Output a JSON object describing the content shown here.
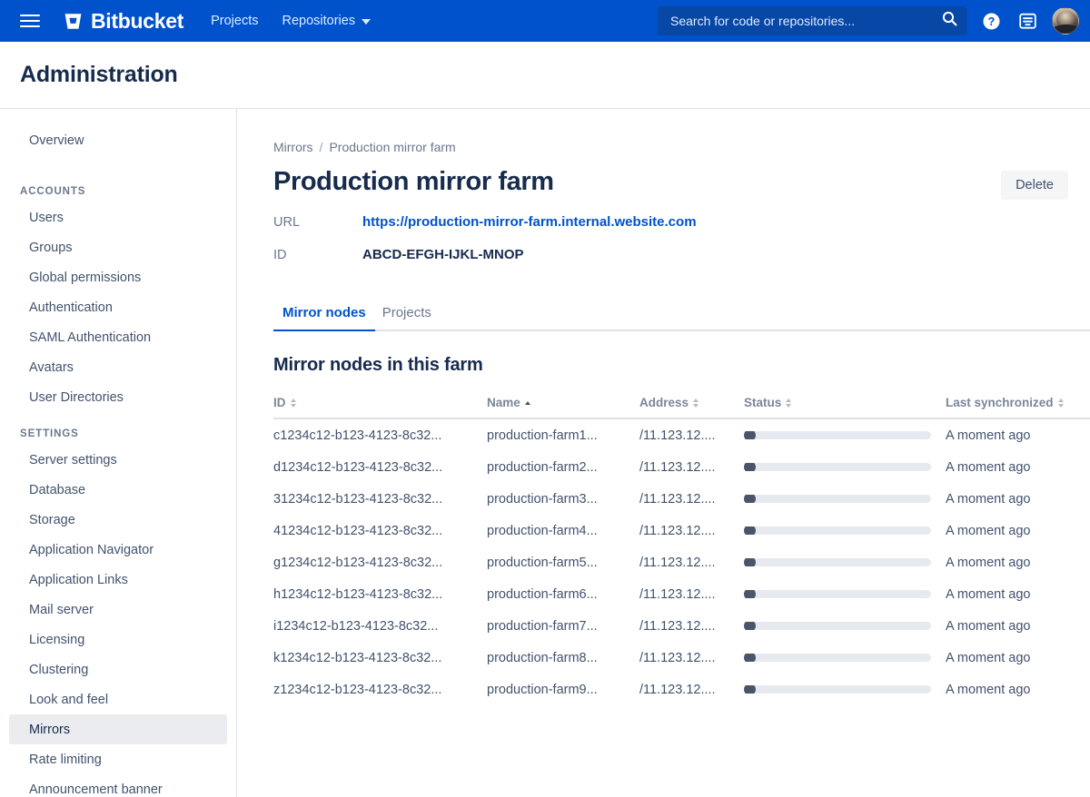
{
  "topnav": {
    "menu_icon": "hamburger-icon",
    "brand": "Bitbucket",
    "links": [
      {
        "label": "Projects",
        "has_caret": false
      },
      {
        "label": "Repositories",
        "has_caret": true
      }
    ],
    "search": {
      "placeholder": "Search for code or repositories...",
      "value": "",
      "icon": "search-icon"
    },
    "help_icon": "help-icon",
    "feed_icon": "notifications-icon",
    "avatar": "user-avatar",
    "brand_color": "#0052CC",
    "search_bg": "#0747A6"
  },
  "page_header": {
    "title": "Administration"
  },
  "sidebar": {
    "top_items": [
      {
        "label": "Overview",
        "active": false
      }
    ],
    "sections": [
      {
        "heading": "ACCOUNTS",
        "items": [
          {
            "label": "Users",
            "active": false
          },
          {
            "label": "Groups",
            "active": false
          },
          {
            "label": "Global permissions",
            "active": false
          },
          {
            "label": "Authentication",
            "active": false
          },
          {
            "label": "SAML Authentication",
            "active": false
          },
          {
            "label": "Avatars",
            "active": false
          },
          {
            "label": "User Directories",
            "active": false
          }
        ]
      },
      {
        "heading": "SETTINGS",
        "items": [
          {
            "label": "Server settings",
            "active": false
          },
          {
            "label": "Database",
            "active": false
          },
          {
            "label": "Storage",
            "active": false
          },
          {
            "label": "Application Navigator",
            "active": false
          },
          {
            "label": "Application Links",
            "active": false
          },
          {
            "label": "Mail server",
            "active": false
          },
          {
            "label": "Licensing",
            "active": false
          },
          {
            "label": "Clustering",
            "active": false
          },
          {
            "label": "Look and feel",
            "active": false
          },
          {
            "label": "Mirrors",
            "active": true
          },
          {
            "label": "Rate limiting",
            "active": false
          },
          {
            "label": "Announcement banner",
            "active": false
          }
        ]
      }
    ]
  },
  "main": {
    "breadcrumb": {
      "parent": "Mirrors",
      "separator": "/",
      "current": "Production mirror farm"
    },
    "title": "Production mirror farm",
    "delete_label": "Delete",
    "meta": [
      {
        "label": "URL",
        "value": "https://production-mirror-farm.internal.website.com",
        "is_link": true
      },
      {
        "label": "ID",
        "value": "ABCD-EFGH-IJKL-MNOP",
        "is_link": false
      }
    ],
    "tabs": [
      {
        "label": "Mirror nodes",
        "active": true
      },
      {
        "label": "Projects",
        "active": false
      }
    ],
    "section_title": "Mirror nodes in this farm",
    "table": {
      "columns": [
        {
          "key": "id",
          "label": "ID",
          "sort": "none"
        },
        {
          "key": "name",
          "label": "Name",
          "sort": "asc"
        },
        {
          "key": "address",
          "label": "Address",
          "sort": "none"
        },
        {
          "key": "status",
          "label": "Status",
          "sort": "none"
        },
        {
          "key": "sync",
          "label": "Last synchronized",
          "sort": "none"
        }
      ],
      "rows": [
        {
          "id": "c1234c12-b123-4123-8c32...",
          "name": "production-farm1...",
          "address": "/11.123.12....",
          "status": "loading",
          "sync": "A moment ago"
        },
        {
          "id": "d1234c12-b123-4123-8c32...",
          "name": "production-farm2...",
          "address": "/11.123.12....",
          "status": "loading",
          "sync": "A moment ago"
        },
        {
          "id": "31234c12-b123-4123-8c32...",
          "name": "production-farm3...",
          "address": "/11.123.12....",
          "status": "loading",
          "sync": "A moment ago"
        },
        {
          "id": "41234c12-b123-4123-8c32...",
          "name": "production-farm4...",
          "address": "/11.123.12....",
          "status": "loading",
          "sync": "A moment ago"
        },
        {
          "id": "g1234c12-b123-4123-8c32...",
          "name": "production-farm5...",
          "address": "/11.123.12....",
          "status": "loading",
          "sync": "A moment ago"
        },
        {
          "id": "h1234c12-b123-4123-8c32...",
          "name": "production-farm6...",
          "address": "/11.123.12....",
          "status": "loading",
          "sync": "A moment ago"
        },
        {
          "id": "i1234c12-b123-4123-8c32...",
          "name": "production-farm7...",
          "address": "/11.123.12....",
          "status": "loading",
          "sync": "A moment ago"
        },
        {
          "id": "k1234c12-b123-4123-8c32...",
          "name": "production-farm8...",
          "address": "/11.123.12....",
          "status": "loading",
          "sync": "A moment ago"
        },
        {
          "id": "z1234c12-b123-4123-8c32...",
          "name": "production-farm9...",
          "address": "/11.123.12....",
          "status": "loading",
          "sync": "A moment ago"
        }
      ]
    }
  }
}
